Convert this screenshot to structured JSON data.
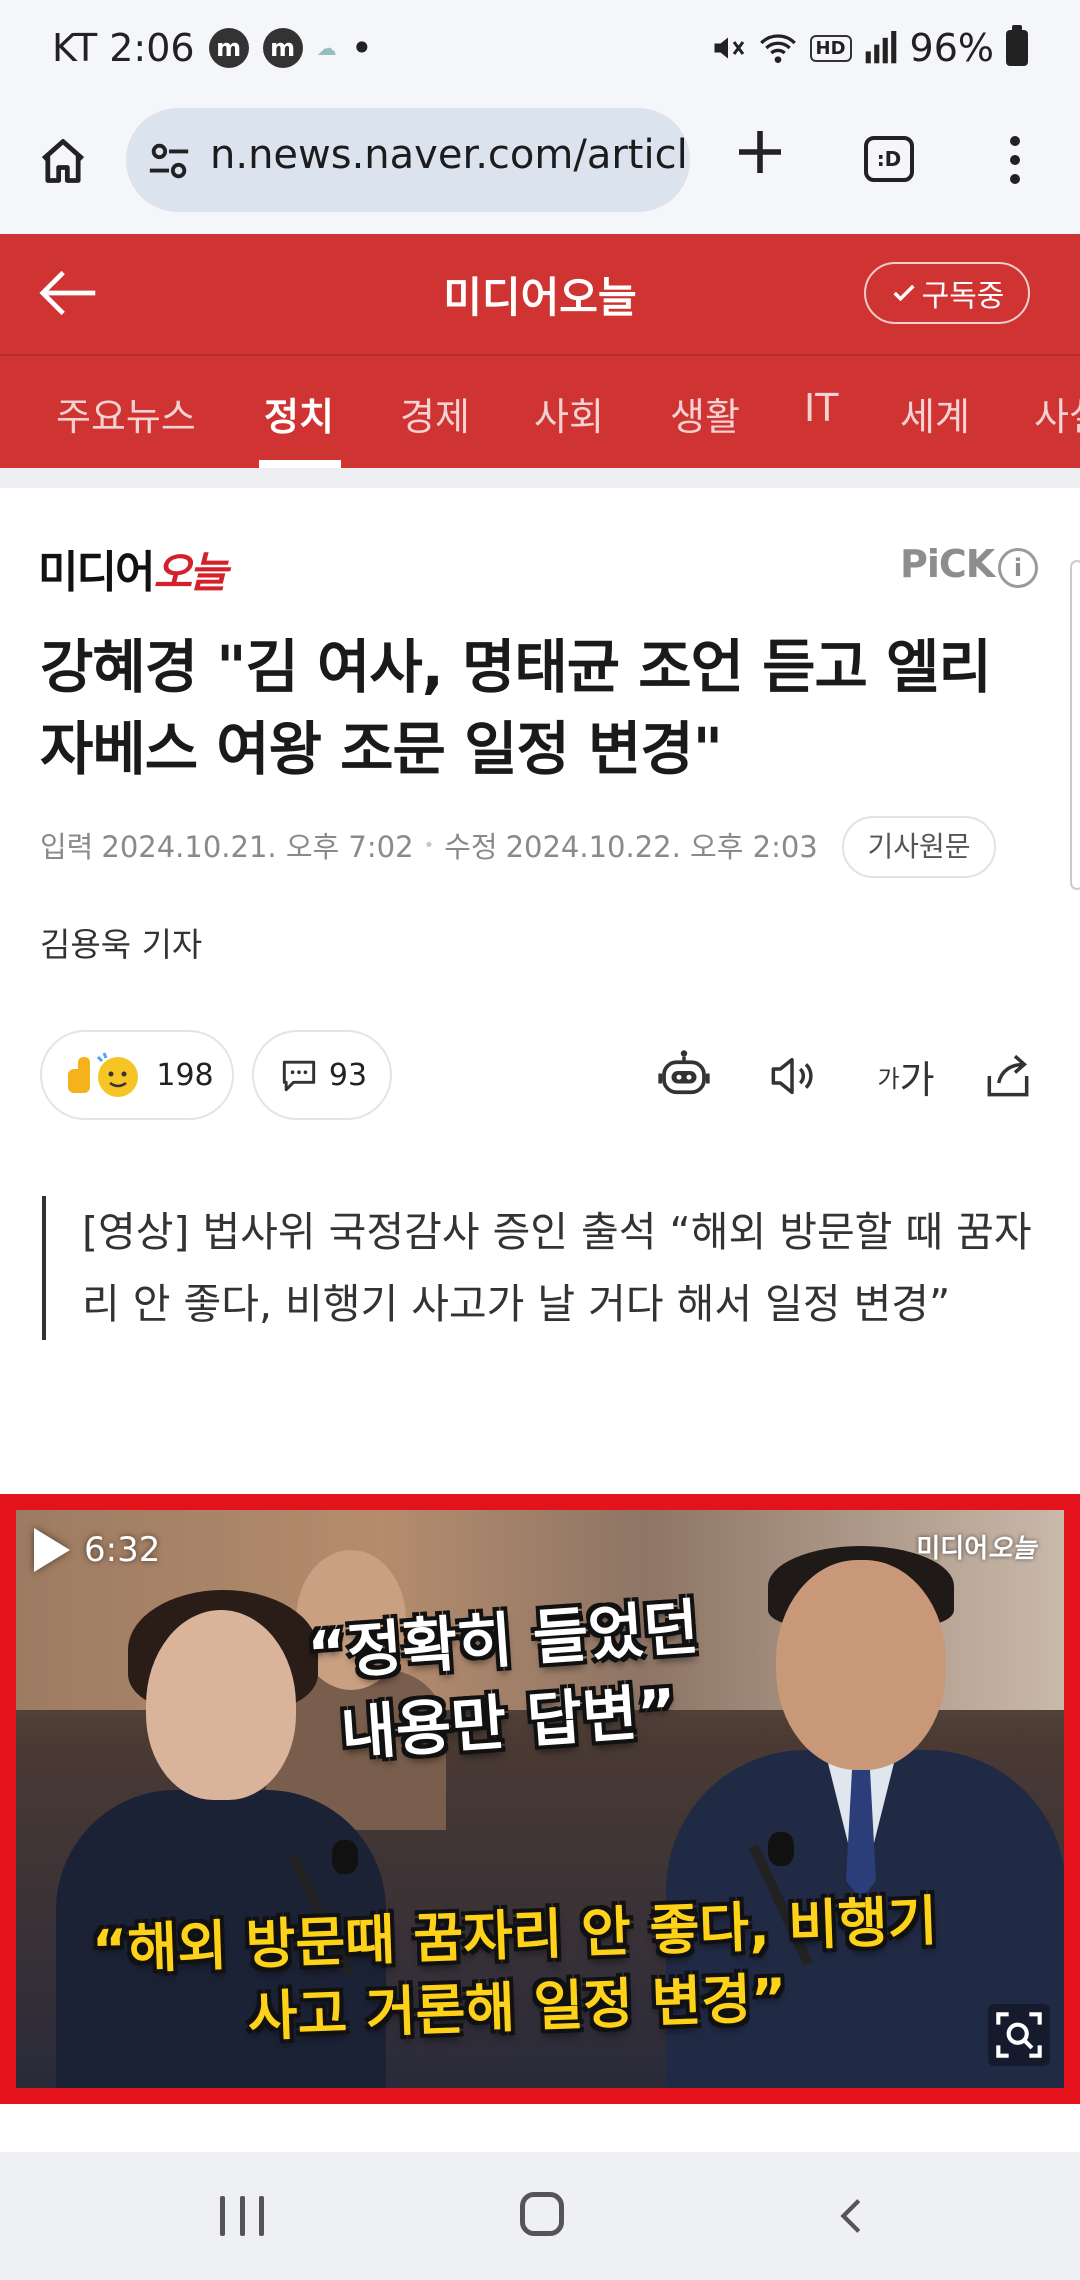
{
  "status_bar": {
    "carrier_time": "KT 2:06",
    "app_icon_1": "m",
    "app_icon_2": "m",
    "dot": "•",
    "hd": "HD",
    "battery": "96%",
    "icons": [
      "mute-icon",
      "wifi-icon",
      "signal-icon",
      "battery-icon"
    ]
  },
  "browser": {
    "url": "n.news.naver.com/article",
    "tabs_label": ":D"
  },
  "press": {
    "name": "미디어오늘",
    "subscribe_label": "구독중",
    "accent_color": "#cf3432"
  },
  "categories": {
    "items": [
      "주요뉴스",
      "정치",
      "경제",
      "사회",
      "생활",
      "IT",
      "세계",
      "사설"
    ],
    "active": "정치"
  },
  "article": {
    "logo_text_a": "미디어",
    "logo_text_b": "오늘",
    "pick_label": "PiCK",
    "pick_info": "i",
    "headline": "강혜경 \"김 여사, 명태균 조언 듣고 엘리자베스 여왕 조문 일정 변경\"",
    "input_label": "입력",
    "input_date": "2024.10.21. 오후 7:02",
    "edit_label": "수정",
    "edit_date": "2024.10.22. 오후 2:03",
    "origin_button": "기사원문",
    "reporter": "김용욱 기자",
    "like_count": "198",
    "comment_count": "93",
    "font_small": "가",
    "font_large": "가",
    "summary": "[영상] 법사위 국정감사 증인 출석 “해외 방문할 때 꿈자리 안 좋다, 비행기 사고가 날 거다 해서 일정 변경”"
  },
  "video": {
    "duration": "6:32",
    "logo_a": "미디어",
    "logo_b": "오늘",
    "caption_top": "“정확히 들었던 내용만 답변”",
    "caption_bottom": "“해외 방문때 꿈자리 안 좋다, 비행기 사고 거론해 일정 변경”",
    "border_color": "#e3121b"
  }
}
